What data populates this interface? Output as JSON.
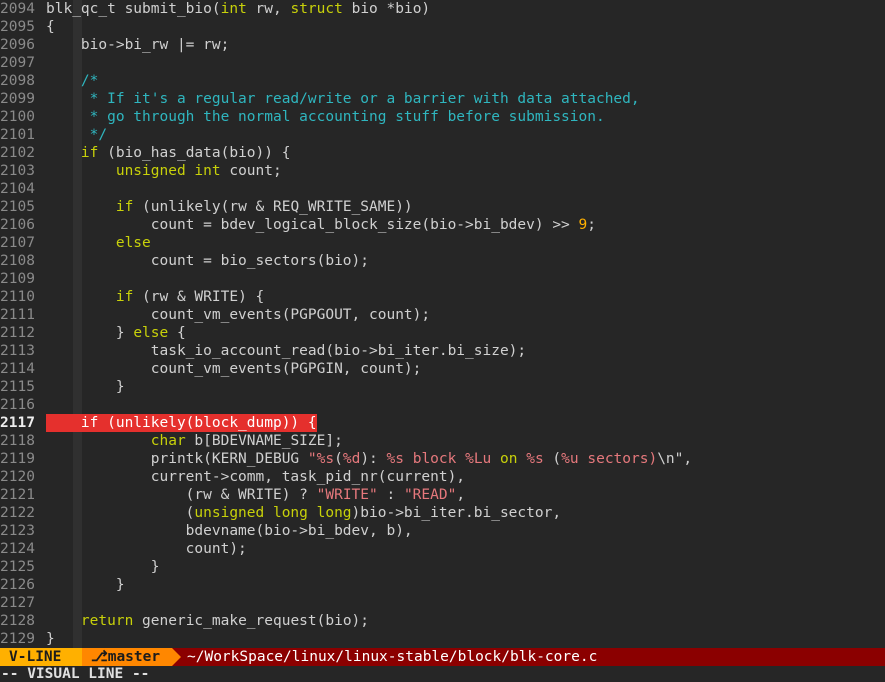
{
  "editor": {
    "lines": [
      {
        "n": "2094",
        "segs": [
          [
            "blk_qc_t submit_bio(",
            ""
          ],
          [
            "int",
            "ty"
          ],
          [
            " rw, ",
            ""
          ],
          [
            "struct",
            "ty"
          ],
          [
            " bio *bio)",
            ""
          ]
        ]
      },
      {
        "n": "2095",
        "segs": [
          [
            "{",
            ""
          ]
        ]
      },
      {
        "n": "2096",
        "segs": [
          [
            "    bio->bi_rw |= rw;",
            ""
          ]
        ]
      },
      {
        "n": "2097",
        "segs": []
      },
      {
        "n": "2098",
        "segs": [
          [
            "    /*",
            "cm"
          ]
        ]
      },
      {
        "n": "2099",
        "segs": [
          [
            "     * If it's a regular read/write or a barrier with data attached,",
            "cm"
          ]
        ]
      },
      {
        "n": "2100",
        "segs": [
          [
            "     * go through the normal accounting stuff before submission.",
            "cm"
          ]
        ]
      },
      {
        "n": "2101",
        "segs": [
          [
            "     */",
            "cm"
          ]
        ]
      },
      {
        "n": "2102",
        "segs": [
          [
            "    ",
            ""
          ],
          [
            "if",
            "kw"
          ],
          [
            " (bio_has_data(bio)) {",
            ""
          ]
        ]
      },
      {
        "n": "2103",
        "segs": [
          [
            "        ",
            ""
          ],
          [
            "unsigned int",
            "ty"
          ],
          [
            " count;",
            ""
          ]
        ]
      },
      {
        "n": "2104",
        "segs": []
      },
      {
        "n": "2105",
        "segs": [
          [
            "        ",
            ""
          ],
          [
            "if",
            "kw"
          ],
          [
            " (unlikely(rw & REQ_WRITE_SAME))",
            ""
          ]
        ]
      },
      {
        "n": "2106",
        "segs": [
          [
            "            count = bdev_logical_block_size(bio->bi_bdev) >> ",
            ""
          ],
          [
            "9",
            "num"
          ],
          [
            ";",
            ""
          ]
        ]
      },
      {
        "n": "2107",
        "segs": [
          [
            "        ",
            ""
          ],
          [
            "else",
            "kw"
          ]
        ]
      },
      {
        "n": "2108",
        "segs": [
          [
            "            count = bio_sectors(bio);",
            ""
          ]
        ]
      },
      {
        "n": "2109",
        "segs": []
      },
      {
        "n": "2110",
        "segs": [
          [
            "        ",
            ""
          ],
          [
            "if",
            "kw"
          ],
          [
            " (rw & WRITE) {",
            ""
          ]
        ]
      },
      {
        "n": "2111",
        "segs": [
          [
            "            count_vm_events(PGPGOUT, count);",
            ""
          ]
        ]
      },
      {
        "n": "2112",
        "segs": [
          [
            "        } ",
            ""
          ],
          [
            "else",
            "kw"
          ],
          [
            " {",
            ""
          ]
        ]
      },
      {
        "n": "2113",
        "segs": [
          [
            "            task_io_account_read(bio->bi_iter.bi_size);",
            ""
          ]
        ]
      },
      {
        "n": "2114",
        "segs": [
          [
            "            count_vm_events(PGPGIN, count);",
            ""
          ]
        ]
      },
      {
        "n": "2115",
        "segs": [
          [
            "        }",
            ""
          ]
        ]
      },
      {
        "n": "2116",
        "segs": []
      },
      {
        "n": "2117",
        "current": true,
        "error": true,
        "segs": [
          [
            "    if (unlikely(block_dump)) {",
            "hl"
          ]
        ]
      },
      {
        "n": "2118",
        "segs": [
          [
            "            ",
            ""
          ],
          [
            "char",
            "ty"
          ],
          [
            " b[BDEVNAME_SIZE];",
            ""
          ]
        ]
      },
      {
        "n": "2119",
        "segs": [
          [
            "            printk(KERN_DEBUG ",
            ""
          ],
          [
            "\"",
            "str"
          ],
          [
            "%s",
            "fmt"
          ],
          [
            "(",
            ""
          ],
          [
            "%d",
            "fmt"
          ],
          [
            "): ",
            ""
          ],
          [
            "%s",
            "fmt"
          ],
          [
            " block ",
            "str"
          ],
          [
            "%Lu",
            "fmt"
          ],
          [
            " on ",
            "kw"
          ],
          [
            "%s",
            "fmt"
          ],
          [
            " (",
            ""
          ],
          [
            "%u",
            "fmt"
          ],
          [
            " sectors)",
            "str"
          ],
          [
            "\\n\"",
            ""
          ],
          [
            ",",
            ""
          ]
        ]
      },
      {
        "n": "2120",
        "segs": [
          [
            "            current->comm, task_pid_nr(current),",
            ""
          ]
        ]
      },
      {
        "n": "2121",
        "segs": [
          [
            "                (rw & WRITE) ? ",
            ""
          ],
          [
            "\"WRITE\"",
            "str"
          ],
          [
            " : ",
            ""
          ],
          [
            "\"READ\"",
            "str"
          ],
          [
            ",",
            ""
          ]
        ]
      },
      {
        "n": "2122",
        "segs": [
          [
            "                (",
            ""
          ],
          [
            "unsigned long long",
            "ty"
          ],
          [
            ")bio->bi_iter.bi_sector,",
            ""
          ]
        ]
      },
      {
        "n": "2123",
        "segs": [
          [
            "                bdevname(bio->bi_bdev, b),",
            ""
          ]
        ]
      },
      {
        "n": "2124",
        "segs": [
          [
            "                count);",
            ""
          ]
        ]
      },
      {
        "n": "2125",
        "segs": [
          [
            "            }",
            ""
          ]
        ]
      },
      {
        "n": "2126",
        "segs": [
          [
            "        }",
            ""
          ]
        ]
      },
      {
        "n": "2127",
        "segs": []
      },
      {
        "n": "2128",
        "segs": [
          [
            "    ",
            ""
          ],
          [
            "return",
            "kw"
          ],
          [
            " generic_make_request(bio);",
            ""
          ]
        ]
      },
      {
        "n": "2129",
        "segs": [
          [
            "}",
            ""
          ]
        ]
      }
    ]
  },
  "statusline": {
    "mode": "V-LINE",
    "branch_icon": "⎇",
    "branch": "master",
    "path": "~/WorkSpace/linux/linux-stable/block/blk-core.c"
  },
  "cmdline": {
    "text": "-- VISUAL LINE --"
  },
  "colors": {
    "error": "#e5302d",
    "mode": "#ffb000",
    "branch": "#ff8700",
    "status_bg": "#8b0000"
  }
}
